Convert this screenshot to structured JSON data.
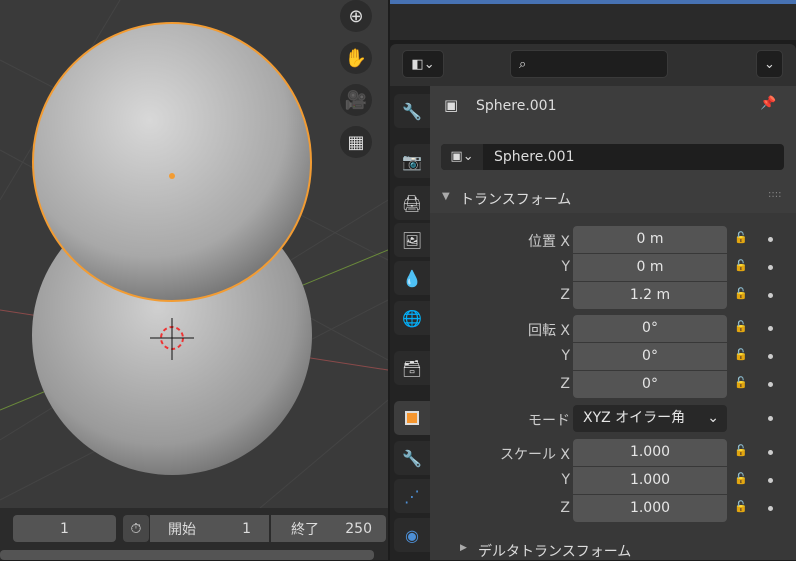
{
  "viewport": {
    "tools": [
      {
        "name": "zoom",
        "icon": "zoom-icon"
      },
      {
        "name": "pan",
        "icon": "hand-icon"
      },
      {
        "name": "camera",
        "icon": "camera-icon"
      },
      {
        "name": "ortho",
        "icon": "grid-icon"
      }
    ]
  },
  "timeline": {
    "current_frame": "1",
    "start_label": "開始",
    "start_value": "1",
    "end_label": "終了",
    "end_value": "250"
  },
  "properties": {
    "object_name": "Sphere.001",
    "datablock_name": "Sphere.001",
    "panel_title": "トランスフォーム",
    "location": {
      "label": "位置 X",
      "y_label": "Y",
      "z_label": "Z",
      "x": "0 m",
      "y": "0 m",
      "z": "1.2 m"
    },
    "rotation": {
      "label": "回転 X",
      "y_label": "Y",
      "z_label": "Z",
      "x": "0°",
      "y": "0°",
      "z": "0°"
    },
    "mode": {
      "label": "モード",
      "value": "XYZ オイラー角"
    },
    "scale": {
      "label": "スケール X",
      "y_label": "Y",
      "z_label": "Z",
      "x": "1.000",
      "y": "1.000",
      "z": "1.000"
    },
    "delta_panel": "デルタトランスフォーム"
  },
  "colors": {
    "accent": "#f5962f",
    "selection": "#f29c33",
    "active_tab": "#545454"
  }
}
